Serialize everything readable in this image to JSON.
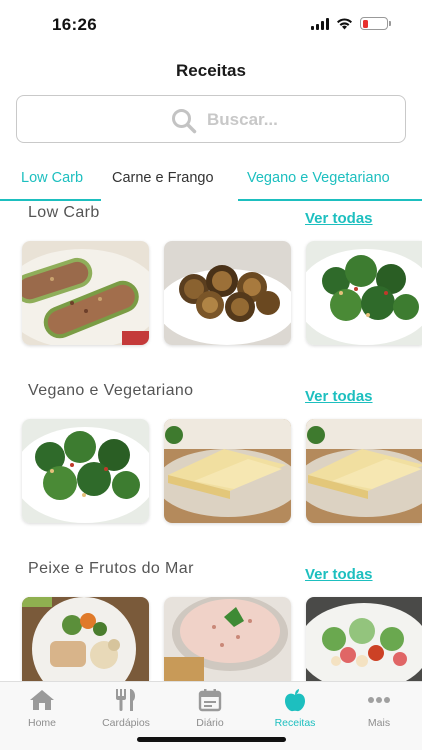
{
  "status_bar": {
    "time": "16:26"
  },
  "page": {
    "title": "Receitas"
  },
  "search": {
    "placeholder": "Buscar..."
  },
  "category_tabs": [
    {
      "label": "Low Carb"
    },
    {
      "label": "Carne e Frango"
    },
    {
      "label": "Vegano e Vegetariano"
    }
  ],
  "sections": [
    {
      "title": "Low Carb",
      "see_all": "Ver todas"
    },
    {
      "title": "Vegano e Vegetariano",
      "see_all": "Ver todas"
    },
    {
      "title": "Peixe e Frutos do Mar",
      "see_all": "Ver todas"
    }
  ],
  "bottom_nav": [
    {
      "label": "Home",
      "icon": "home-icon"
    },
    {
      "label": "Cardápios",
      "icon": "cutlery-icon"
    },
    {
      "label": "Diário",
      "icon": "calendar-icon"
    },
    {
      "label": "Receitas",
      "icon": "apple-icon"
    },
    {
      "label": "Mais",
      "icon": "more-icon"
    }
  ],
  "colors": {
    "accent": "#1dbfbf",
    "battery_low": "#e8302e"
  }
}
